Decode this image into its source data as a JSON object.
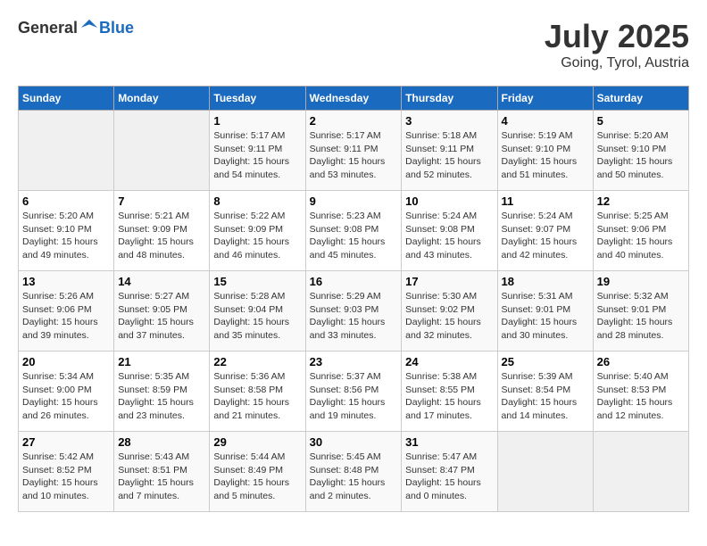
{
  "header": {
    "logo_general": "General",
    "logo_blue": "Blue",
    "title": "July 2025",
    "subtitle": "Going, Tyrol, Austria"
  },
  "weekdays": [
    "Sunday",
    "Monday",
    "Tuesday",
    "Wednesday",
    "Thursday",
    "Friday",
    "Saturday"
  ],
  "weeks": [
    [
      {
        "day": "",
        "empty": true
      },
      {
        "day": "",
        "empty": true
      },
      {
        "day": "1",
        "sunrise": "Sunrise: 5:17 AM",
        "sunset": "Sunset: 9:11 PM",
        "daylight": "Daylight: 15 hours and 54 minutes."
      },
      {
        "day": "2",
        "sunrise": "Sunrise: 5:17 AM",
        "sunset": "Sunset: 9:11 PM",
        "daylight": "Daylight: 15 hours and 53 minutes."
      },
      {
        "day": "3",
        "sunrise": "Sunrise: 5:18 AM",
        "sunset": "Sunset: 9:11 PM",
        "daylight": "Daylight: 15 hours and 52 minutes."
      },
      {
        "day": "4",
        "sunrise": "Sunrise: 5:19 AM",
        "sunset": "Sunset: 9:10 PM",
        "daylight": "Daylight: 15 hours and 51 minutes."
      },
      {
        "day": "5",
        "sunrise": "Sunrise: 5:20 AM",
        "sunset": "Sunset: 9:10 PM",
        "daylight": "Daylight: 15 hours and 50 minutes."
      }
    ],
    [
      {
        "day": "6",
        "sunrise": "Sunrise: 5:20 AM",
        "sunset": "Sunset: 9:10 PM",
        "daylight": "Daylight: 15 hours and 49 minutes."
      },
      {
        "day": "7",
        "sunrise": "Sunrise: 5:21 AM",
        "sunset": "Sunset: 9:09 PM",
        "daylight": "Daylight: 15 hours and 48 minutes."
      },
      {
        "day": "8",
        "sunrise": "Sunrise: 5:22 AM",
        "sunset": "Sunset: 9:09 PM",
        "daylight": "Daylight: 15 hours and 46 minutes."
      },
      {
        "day": "9",
        "sunrise": "Sunrise: 5:23 AM",
        "sunset": "Sunset: 9:08 PM",
        "daylight": "Daylight: 15 hours and 45 minutes."
      },
      {
        "day": "10",
        "sunrise": "Sunrise: 5:24 AM",
        "sunset": "Sunset: 9:08 PM",
        "daylight": "Daylight: 15 hours and 43 minutes."
      },
      {
        "day": "11",
        "sunrise": "Sunrise: 5:24 AM",
        "sunset": "Sunset: 9:07 PM",
        "daylight": "Daylight: 15 hours and 42 minutes."
      },
      {
        "day": "12",
        "sunrise": "Sunrise: 5:25 AM",
        "sunset": "Sunset: 9:06 PM",
        "daylight": "Daylight: 15 hours and 40 minutes."
      }
    ],
    [
      {
        "day": "13",
        "sunrise": "Sunrise: 5:26 AM",
        "sunset": "Sunset: 9:06 PM",
        "daylight": "Daylight: 15 hours and 39 minutes."
      },
      {
        "day": "14",
        "sunrise": "Sunrise: 5:27 AM",
        "sunset": "Sunset: 9:05 PM",
        "daylight": "Daylight: 15 hours and 37 minutes."
      },
      {
        "day": "15",
        "sunrise": "Sunrise: 5:28 AM",
        "sunset": "Sunset: 9:04 PM",
        "daylight": "Daylight: 15 hours and 35 minutes."
      },
      {
        "day": "16",
        "sunrise": "Sunrise: 5:29 AM",
        "sunset": "Sunset: 9:03 PM",
        "daylight": "Daylight: 15 hours and 33 minutes."
      },
      {
        "day": "17",
        "sunrise": "Sunrise: 5:30 AM",
        "sunset": "Sunset: 9:02 PM",
        "daylight": "Daylight: 15 hours and 32 minutes."
      },
      {
        "day": "18",
        "sunrise": "Sunrise: 5:31 AM",
        "sunset": "Sunset: 9:01 PM",
        "daylight": "Daylight: 15 hours and 30 minutes."
      },
      {
        "day": "19",
        "sunrise": "Sunrise: 5:32 AM",
        "sunset": "Sunset: 9:01 PM",
        "daylight": "Daylight: 15 hours and 28 minutes."
      }
    ],
    [
      {
        "day": "20",
        "sunrise": "Sunrise: 5:34 AM",
        "sunset": "Sunset: 9:00 PM",
        "daylight": "Daylight: 15 hours and 26 minutes."
      },
      {
        "day": "21",
        "sunrise": "Sunrise: 5:35 AM",
        "sunset": "Sunset: 8:59 PM",
        "daylight": "Daylight: 15 hours and 23 minutes."
      },
      {
        "day": "22",
        "sunrise": "Sunrise: 5:36 AM",
        "sunset": "Sunset: 8:58 PM",
        "daylight": "Daylight: 15 hours and 21 minutes."
      },
      {
        "day": "23",
        "sunrise": "Sunrise: 5:37 AM",
        "sunset": "Sunset: 8:56 PM",
        "daylight": "Daylight: 15 hours and 19 minutes."
      },
      {
        "day": "24",
        "sunrise": "Sunrise: 5:38 AM",
        "sunset": "Sunset: 8:55 PM",
        "daylight": "Daylight: 15 hours and 17 minutes."
      },
      {
        "day": "25",
        "sunrise": "Sunrise: 5:39 AM",
        "sunset": "Sunset: 8:54 PM",
        "daylight": "Daylight: 15 hours and 14 minutes."
      },
      {
        "day": "26",
        "sunrise": "Sunrise: 5:40 AM",
        "sunset": "Sunset: 8:53 PM",
        "daylight": "Daylight: 15 hours and 12 minutes."
      }
    ],
    [
      {
        "day": "27",
        "sunrise": "Sunrise: 5:42 AM",
        "sunset": "Sunset: 8:52 PM",
        "daylight": "Daylight: 15 hours and 10 minutes."
      },
      {
        "day": "28",
        "sunrise": "Sunrise: 5:43 AM",
        "sunset": "Sunset: 8:51 PM",
        "daylight": "Daylight: 15 hours and 7 minutes."
      },
      {
        "day": "29",
        "sunrise": "Sunrise: 5:44 AM",
        "sunset": "Sunset: 8:49 PM",
        "daylight": "Daylight: 15 hours and 5 minutes."
      },
      {
        "day": "30",
        "sunrise": "Sunrise: 5:45 AM",
        "sunset": "Sunset: 8:48 PM",
        "daylight": "Daylight: 15 hours and 2 minutes."
      },
      {
        "day": "31",
        "sunrise": "Sunrise: 5:47 AM",
        "sunset": "Sunset: 8:47 PM",
        "daylight": "Daylight: 15 hours and 0 minutes."
      },
      {
        "day": "",
        "empty": true
      },
      {
        "day": "",
        "empty": true
      }
    ]
  ]
}
